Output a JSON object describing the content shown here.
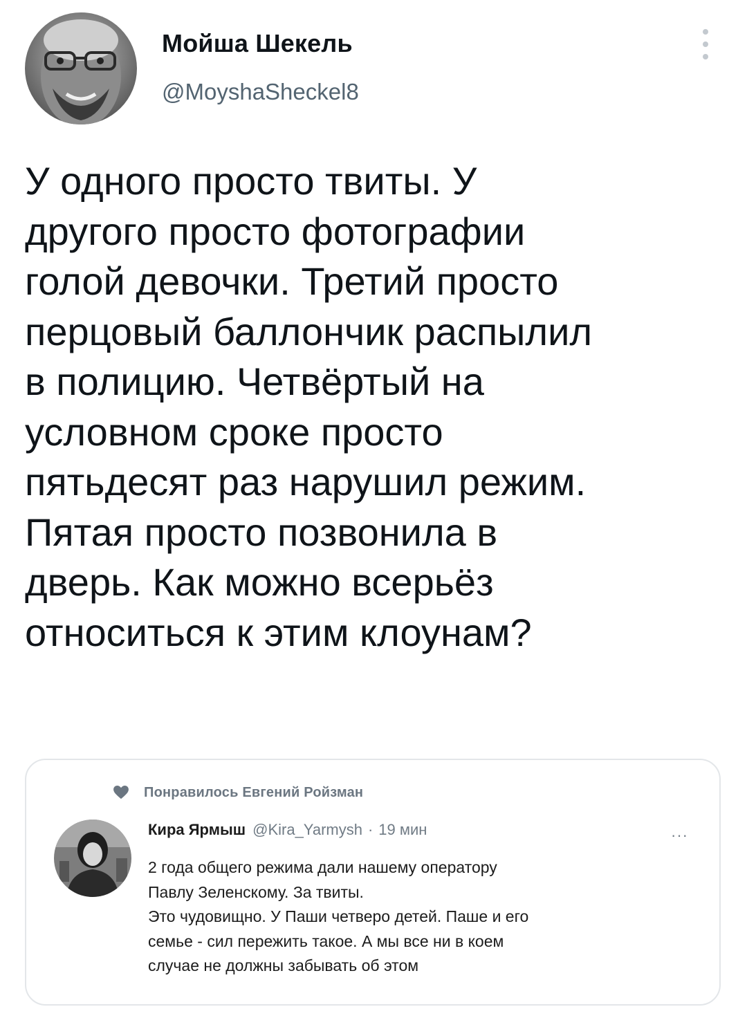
{
  "tweet": {
    "author": {
      "display_name": "Мойша Шекель",
      "handle": "@MoyshaSheckel8",
      "avatar": "avatar"
    },
    "more_icon": "more-vertical-icon",
    "text_lines": [
      "У одного просто твиты. У",
      "другого просто фотографии",
      "голой девочки. Третий просто",
      "перцовый баллончик распылил",
      "в полицию. Четвёртый на",
      "условном сроке просто",
      "пятьдесят раз нарушил режим.",
      "Пятая просто позвонила в",
      "дверь. Как можно всерьёз",
      "относиться к этим клоунам?"
    ]
  },
  "embedded": {
    "liked_icon": "heart-icon",
    "liked_by": "Понравилось Евгений Ройзман",
    "author_name": "Кира Ярмыш",
    "author_handle": "@Kira_Yarmysh",
    "separator": "·",
    "time": "19 мин",
    "more": "···",
    "text_lines": [
      "2 года общего режима дали нашему оператору",
      "Павлу Зеленскому. За твиты.",
      "Это чудовищно. У Паши четверо детей. Паше и его",
      "семье - сил пережить такое. А мы все ни в коем",
      "случае не должны забывать об этом"
    ],
    "colors": {
      "border": "#e3e6e9",
      "secondary_text": "#707b85"
    }
  }
}
